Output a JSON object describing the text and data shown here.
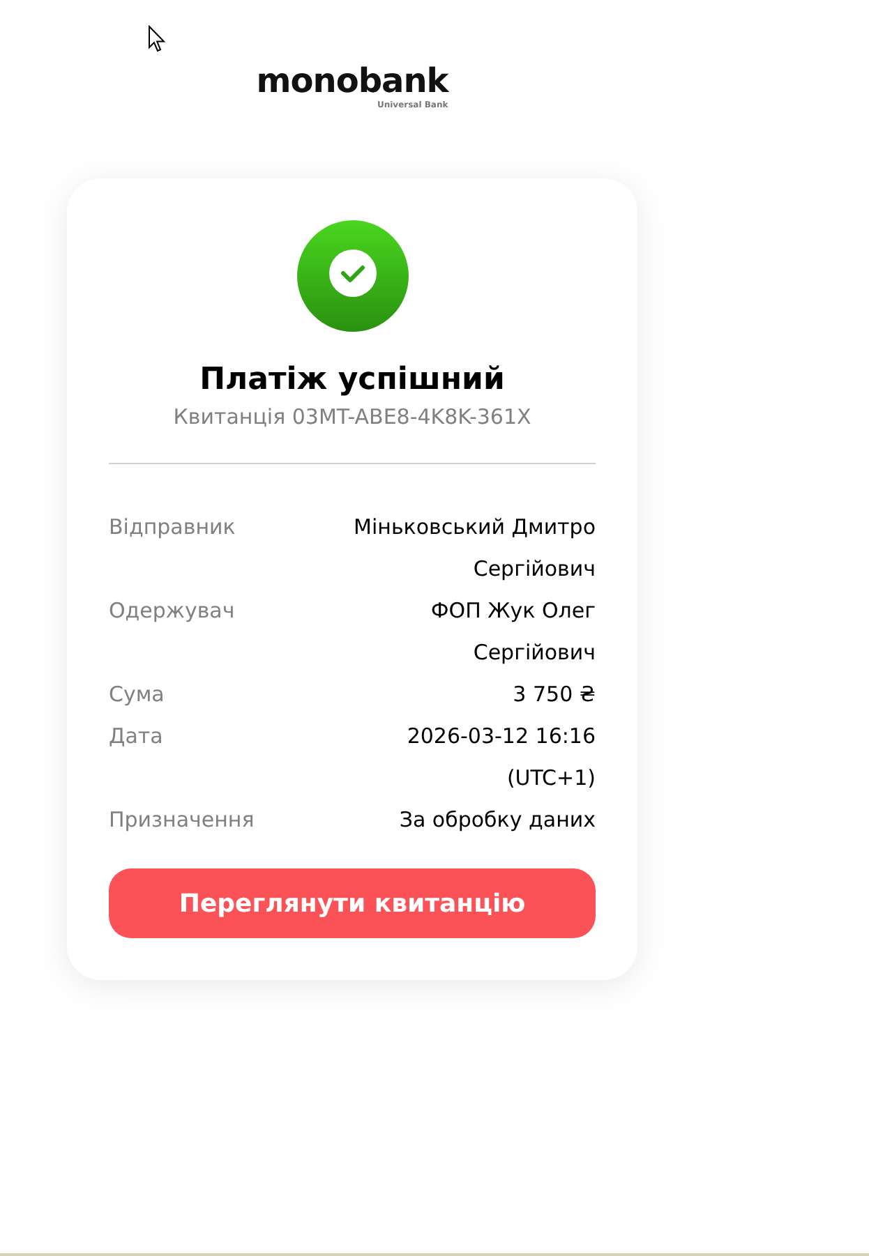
{
  "logo": {
    "name": "monobank",
    "tagline": "Universal Bank"
  },
  "card": {
    "title": "Платіж успішний",
    "receipt": "Квитанція 03MT-ABE8-4K8K-361X",
    "details": [
      {
        "label": "Відправник",
        "value": "Міньковський Дмитро Сергійович"
      },
      {
        "label": "Одержувач",
        "value": "ФОП Жук Олег Сергійович"
      },
      {
        "label": "Сума",
        "value": "3 750 ₴"
      },
      {
        "label": "Дата",
        "value": "2026-03-12 16:16 (UTC+1)"
      },
      {
        "label": "Призначення",
        "value": "За обробку даних"
      }
    ],
    "button": "Переглянути квитанцію"
  }
}
